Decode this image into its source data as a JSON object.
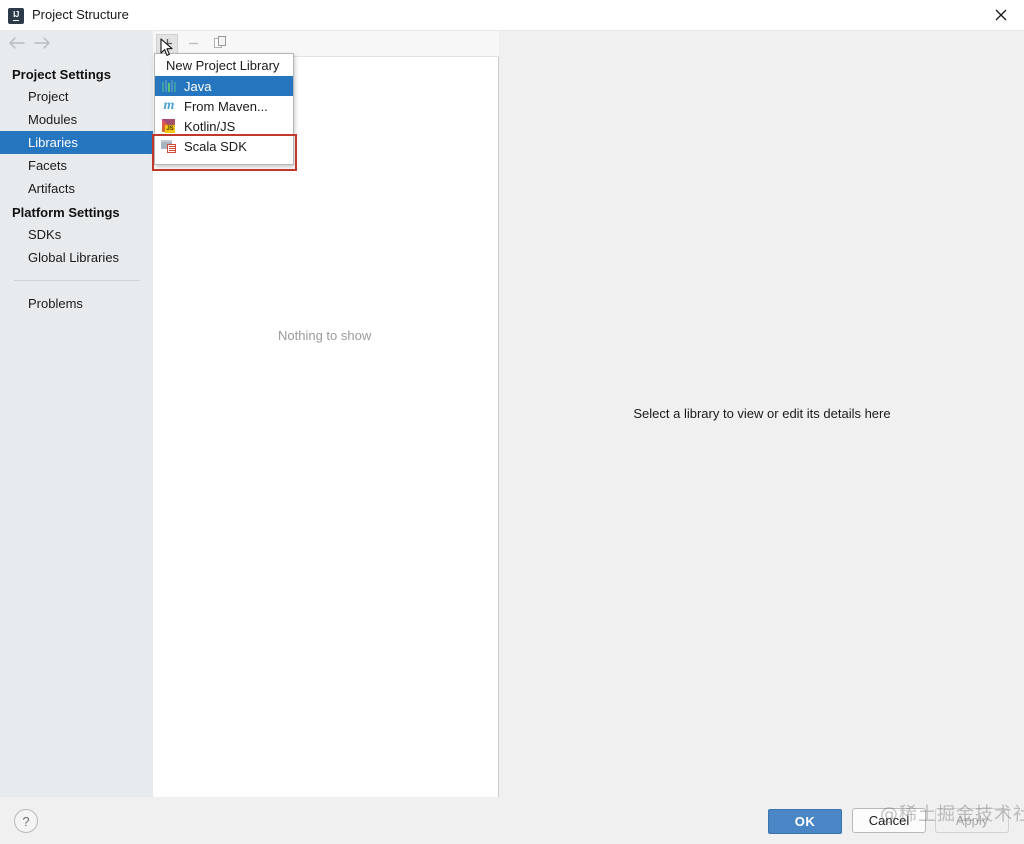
{
  "window": {
    "title": "Project Structure",
    "app_icon": "IJ",
    "close_icon": "close-icon"
  },
  "nav": {
    "back_icon": "arrow-left-icon",
    "forward_icon": "arrow-right-icon"
  },
  "sidebar": {
    "groups": [
      {
        "label": "Project Settings",
        "items": [
          {
            "label": "Project",
            "selected": false
          },
          {
            "label": "Modules",
            "selected": false
          },
          {
            "label": "Libraries",
            "selected": true
          },
          {
            "label": "Facets",
            "selected": false
          },
          {
            "label": "Artifacts",
            "selected": false
          }
        ]
      },
      {
        "label": "Platform Settings",
        "items": [
          {
            "label": "SDKs",
            "selected": false
          },
          {
            "label": "Global Libraries",
            "selected": false
          }
        ]
      }
    ],
    "extra": {
      "label": "Problems"
    }
  },
  "toolbar": {
    "add_label": "+",
    "add_icon": "plus-icon",
    "remove_label": "−",
    "remove_icon": "minus-icon",
    "copy_icon": "copy-icon"
  },
  "center": {
    "empty_text": "Nothing to show"
  },
  "popup": {
    "header": "New Project Library",
    "items": [
      {
        "label": "Java",
        "icon": "java-icon",
        "highlighted": true
      },
      {
        "label": "From Maven...",
        "icon": "maven-icon",
        "highlighted": false
      },
      {
        "label": "Kotlin/JS",
        "icon": "kotlin-js-icon",
        "highlighted": false
      },
      {
        "label": "Scala SDK",
        "icon": "scala-sdk-icon",
        "highlighted": false
      }
    ]
  },
  "annotation": {
    "highlight_color": "#c0392b"
  },
  "detail": {
    "hint": "Select a library to view or edit its details here"
  },
  "footer": {
    "help_label": "?",
    "ok_label": "OK",
    "cancel_label": "Cancel",
    "apply_label": "Apply"
  },
  "watermark": {
    "text": "@稀土掘金技术社区"
  },
  "colors": {
    "accent": "#2675bf",
    "ok_button": "#4a86c5",
    "sidebar_bg": "#e7ebee",
    "panel_bg": "#f0f0f0"
  }
}
